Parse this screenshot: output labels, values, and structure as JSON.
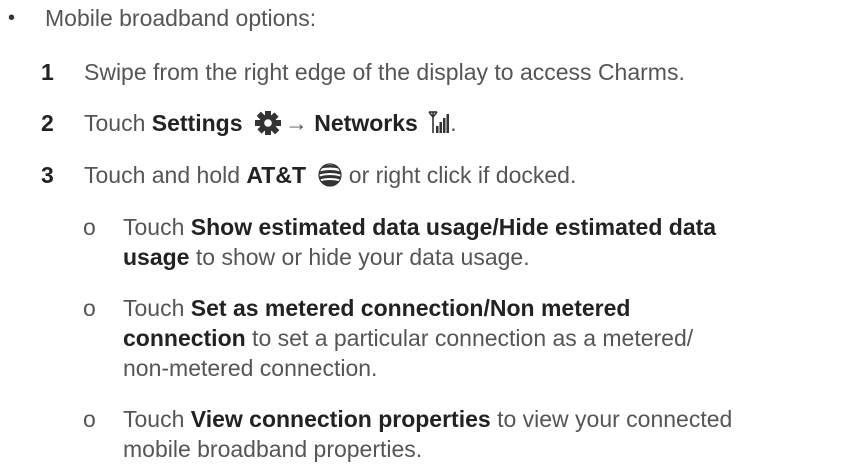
{
  "bullet": {
    "marker": "•",
    "text": "Mobile broadband options:"
  },
  "steps": [
    {
      "number": "1",
      "text": "Swipe from the right edge of the display to access Charms."
    },
    {
      "number": "2",
      "prefix": "Touch ",
      "settings_label": "Settings",
      "settings_icon": "gear-icon",
      "arrow": "→",
      "networks_label": "Networks",
      "networks_icon": "signal-bars-icon",
      "end": "."
    },
    {
      "number": "3",
      "prefix": "Touch and hold ",
      "carrier_label": "AT&T",
      "carrier_icon": "att-globe-icon",
      "suffix": " or right click if docked."
    }
  ],
  "sub_items": [
    {
      "marker": "o",
      "prefix": "Touch ",
      "bold_line1": "Show estimated data usage/Hide estimated data",
      "bold_line2": "usage",
      "suffix": " to show or hide your data usage."
    },
    {
      "marker": "o",
      "prefix": "Touch ",
      "bold_line1": "Set as metered connection/Non metered",
      "bold_line2": "connection",
      "suffix_line2": " to set a particular connection as a metered/",
      "line3": "non-metered connection."
    },
    {
      "marker": "o",
      "prefix": "Touch ",
      "bold": "View connection properties",
      "suffix_line1": " to view your connected",
      "line2": "mobile broadband properties."
    }
  ],
  "colors": {
    "body_text": "#555555",
    "bold_text": "#222222",
    "icon": "#333333"
  }
}
